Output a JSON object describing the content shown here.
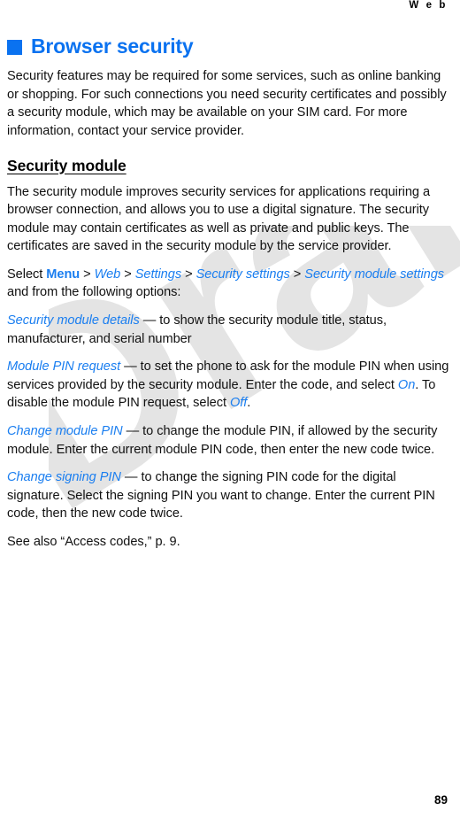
{
  "header": {
    "running_head": "W e b"
  },
  "chapter": {
    "bullet_color": "#0a72f0",
    "title": "Browser security",
    "intro": "Security features may be required for some services, such as online banking or shopping. For such connections you need security certificates and possibly a security module, which may be available on your SIM card. For more information, contact your service provider."
  },
  "section": {
    "heading": "Security module",
    "body": "The security module improves security services for applications requiring a browser connection, and allows you to use a digital signature. The security module may contain certificates as well as private and public keys. The certificates are saved in the security module by the service provider."
  },
  "navigation": {
    "lead": "Select ",
    "menu": "Menu",
    "sep": " > ",
    "path": [
      "Web",
      "Settings",
      "Security settings",
      "Security module settings"
    ],
    "trail": " and from the following options:"
  },
  "options": [
    {
      "term": "Security module details",
      "dash": " — ",
      "description": "to show the security module title, status, manufacturer, and serial number"
    },
    {
      "term": "Module PIN request",
      "dash": " — ",
      "desc_part1": "to set the phone to ask for the module PIN when using services provided by the security module. Enter the code, and select ",
      "inline1": "On",
      "desc_part2": ". To disable the module PIN request, select ",
      "inline2": "Off",
      "desc_part3": "."
    },
    {
      "term": "Change module PIN",
      "dash": " — ",
      "description": "to change the module PIN, if allowed by the security module. Enter the current module PIN code, then enter the new code twice."
    },
    {
      "term": "Change signing PIN",
      "dash": " — ",
      "description": "to change the signing PIN code for the digital signature. Select the signing PIN you want to change. Enter the current PIN code, then the new code twice."
    }
  ],
  "cross_reference": "See also “Access codes,” p. 9.",
  "footer": {
    "page_number": "89"
  },
  "watermark": {
    "text": "Draft",
    "color": "#e4e4e4"
  }
}
